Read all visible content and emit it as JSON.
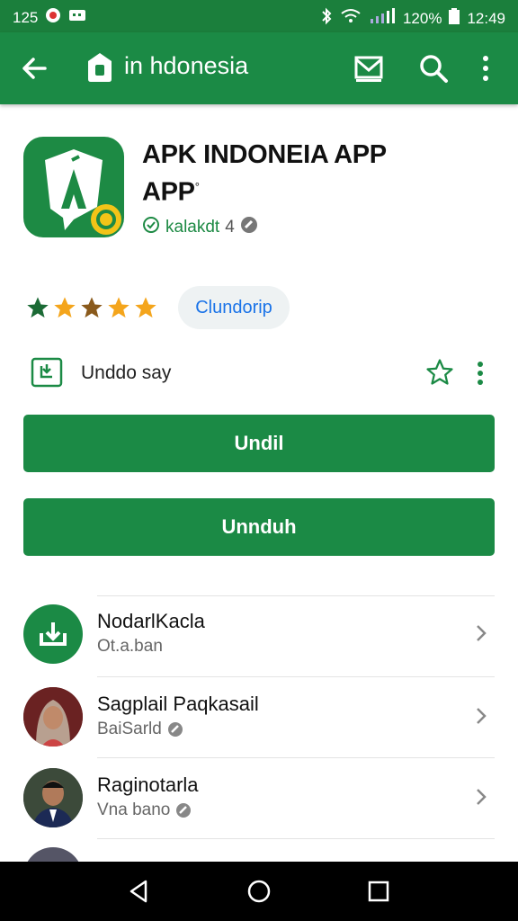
{
  "status_bar": {
    "time_left": "125",
    "battery": "120%",
    "time_right": "12:49"
  },
  "app_bar": {
    "title": "in hdonesia"
  },
  "app": {
    "title": "APK INDONEIA APP APP",
    "title_mark": "°",
    "developer": "kalakdt",
    "version": "4",
    "rating_stars": 5,
    "chip_label": "Clundorip"
  },
  "info_row": {
    "label": "Unddo say"
  },
  "buttons": {
    "primary": "Undil",
    "secondary": "Unnduh"
  },
  "list": [
    {
      "name": "NodarlKacla",
      "sub": "Ot.a.ban"
    },
    {
      "name": "Sagplail Paqkasail",
      "sub": "BaiSarld"
    },
    {
      "name": "Raginotarla",
      "sub": "Vna bano"
    }
  ],
  "colors": {
    "primary": "#1b8a45",
    "status": "#1b7f3c",
    "link": "#1a73e8",
    "accent_yellow": "#f2c418"
  }
}
